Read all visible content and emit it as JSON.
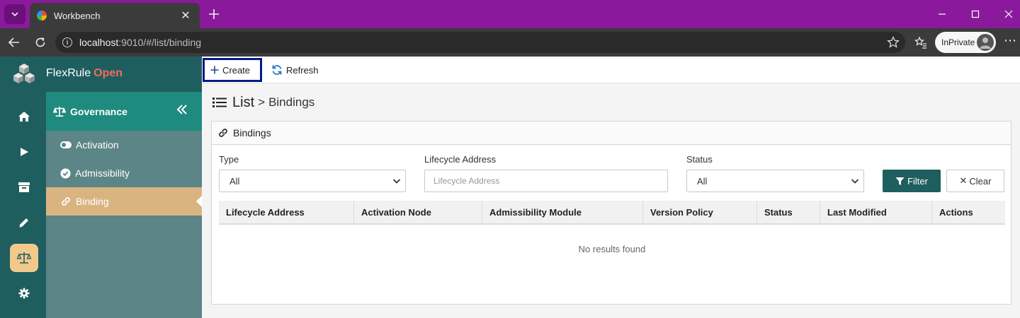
{
  "browser": {
    "tab_title": "Workbench",
    "url_host": "localhost",
    "url_rest": ":9010/#/list/binding",
    "profile_label": "InPrivate"
  },
  "app": {
    "brand_name": "FlexRule",
    "brand_suffix": "Open",
    "colors": {
      "rail": "#1f5e5e",
      "accent": "#1f8a80",
      "active_item": "#d9b481",
      "brand_suffix": "#ef6c5b"
    },
    "rail_icons": [
      "home-icon",
      "play-icon",
      "archive-icon",
      "pencil-icon",
      "balance-scale-icon",
      "gear-icon"
    ],
    "active_rail_icon": "balance-scale-icon"
  },
  "subnav": {
    "title": "Governance",
    "items": [
      {
        "label": "Activation",
        "icon": "toggle-icon"
      },
      {
        "label": "Admissibility",
        "icon": "check-circle-icon"
      },
      {
        "label": "Binding",
        "icon": "link-icon"
      }
    ],
    "active_item": "Binding"
  },
  "toolbar": {
    "create_label": "Create",
    "refresh_label": "Refresh"
  },
  "page": {
    "title": "List",
    "separator": ">",
    "crumb": "Bindings"
  },
  "panel": {
    "title": "Bindings",
    "filters": {
      "type_label": "Type",
      "type_value": "All",
      "lifecycle_label": "Lifecycle Address",
      "lifecycle_placeholder": "Lifecycle Address",
      "status_label": "Status",
      "status_value": "All"
    },
    "filter_button": "Filter",
    "clear_button": "Clear",
    "columns": [
      "Lifecycle Address",
      "Activation Node",
      "Admissibility Module",
      "Version Policy",
      "Status",
      "Last Modified",
      "Actions"
    ],
    "empty_message": "No results found"
  }
}
